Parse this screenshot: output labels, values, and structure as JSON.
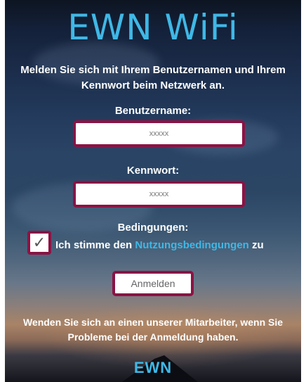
{
  "header": {
    "title": "EWN WiFi",
    "intro_line1": "Melden Sie sich mit Ihrem Benutzernamen und Ihrem",
    "intro_line2": "Kennwort beim Netzwerk an."
  },
  "form": {
    "username_label": "Benutzername:",
    "username_placeholder": "xxxxx",
    "password_label": "Kennwort:",
    "password_placeholder": "xxxxx",
    "terms_label": "Bedingungen:",
    "terms_checkbox_mark": "✓",
    "terms_checked": true,
    "terms_text_before": "Ich stimme den ",
    "terms_link": "Nutzungsbedingungen",
    "terms_text_after": " zu",
    "submit_label": "Anmelden"
  },
  "footer": {
    "help_line1": "Wenden Sie sich an einen unserer Mitarbeiter, wenn Sie",
    "help_line2": "Probleme bei der Anmeldung haben.",
    "logo": "EWN"
  },
  "colors": {
    "accent": "#3fb8e6",
    "border": "#8b1344"
  }
}
